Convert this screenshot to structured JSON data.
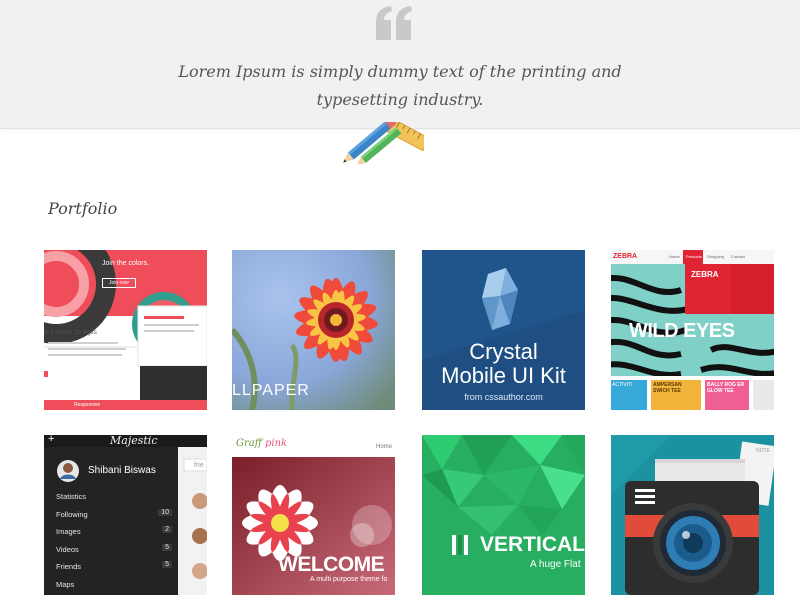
{
  "quote": {
    "text_line1": "Lorem Ipsum is simply dummy text of the printing and",
    "text_line2": "typesetting industry."
  },
  "section": {
    "title": "Portfolio"
  },
  "portfolio": {
    "items": [
      {
        "name": "join-the-colors",
        "headline": "Join the colors.",
        "button": "Join now",
        "caption": "ly 3 colors, 10 digits",
        "footer": "Responsive"
      },
      {
        "name": "flower-wallpaper",
        "caption": "LLPAPER"
      },
      {
        "name": "crystal-mobile-ui-kit",
        "line1": "Crystal",
        "line2": "Mobile UI Kit",
        "credit": "from cssauthor.com"
      },
      {
        "name": "zebra-wild-eyes",
        "brand": "ZEBRA",
        "nav": [
          "Home",
          "Products",
          "Shopping",
          "Contact"
        ],
        "logo": "ZEBRA",
        "headline": "WILD EYES",
        "sub1": "ACTIVITI",
        "sub2": "AMPERSAN SWICH TEE",
        "sub3": "BALLY ROG ER GLOW TEE"
      },
      {
        "name": "majestic-app",
        "title": "Majestic",
        "user": "Shibani Biswas",
        "search": "frie",
        "menu": [
          {
            "label": "Statistics",
            "count": ""
          },
          {
            "label": "Following",
            "count": "10"
          },
          {
            "label": "Images",
            "count": "2"
          },
          {
            "label": "Videos",
            "count": "5"
          },
          {
            "label": "Friends",
            "count": "5"
          },
          {
            "label": "Maps",
            "count": ""
          }
        ]
      },
      {
        "name": "graff-pink",
        "brand_a": "Graff",
        "brand_b": "pink",
        "nav": "Home",
        "headline": "WELCOME",
        "sub": "A multi purpose theme fo"
      },
      {
        "name": "vertical-flat",
        "headline": "VERTICAL",
        "sub": "A huge Flat"
      },
      {
        "name": "camera-icon",
        "label": "NOTE"
      }
    ]
  },
  "colors": {
    "band": "#f1f1f1",
    "text": "#555555",
    "accent_red": "#ef4d5a",
    "crystal_blue": "#1f4f82",
    "vertical_green": "#27ae60",
    "camera_teal": "#1e9aa8"
  }
}
